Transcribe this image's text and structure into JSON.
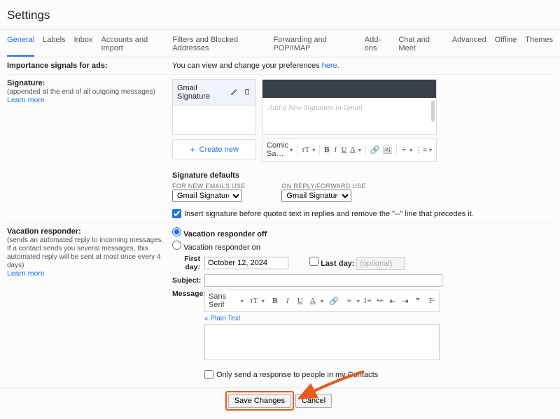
{
  "page_title": "Settings",
  "tabs": [
    "General",
    "Labels",
    "Inbox",
    "Accounts and Import",
    "Filters and Blocked Addresses",
    "Forwarding and POP/IMAP",
    "Add-ons",
    "Chat and Meet",
    "Advanced",
    "Offline",
    "Themes"
  ],
  "active_tab": "General",
  "ads": {
    "label": "Importance signals for ads:",
    "text_prefix": "You can view and change your preferences ",
    "link": "here"
  },
  "signature": {
    "label": "Signature:",
    "sub": "(appended at the end of all outgoing messages)",
    "learn": "Learn more",
    "list_item": "Gmail Signature",
    "preview_text": "Add a New Signature in Gmail",
    "font_name": "Comic Sa…",
    "create_new": "Create new",
    "defaults_heading": "Signature defaults",
    "new_emails_label": "FOR NEW EMAILS USE",
    "reply_label": "ON REPLY/FORWARD USE",
    "select_value": "Gmail Signature",
    "insert_checkbox": "Insert signature before quoted text in replies and remove the \"--\" line that precedes it."
  },
  "vacation": {
    "label": "Vacation responder:",
    "sub": "(sends an automated reply to incoming messages. If a contact sends you several messages, this automated reply will be sent at most once every 4 days)",
    "learn": "Learn more",
    "off": "Vacation responder off",
    "on": "Vacation responder on",
    "first_day_label": "First day:",
    "first_day_value": "October 12, 2024",
    "last_day_label": "Last day:",
    "last_day_placeholder": "(optional)",
    "subject_label": "Subject:",
    "message_label": "Message:",
    "font_name": "Sans Serif",
    "plain_text": "« Plain Text",
    "contacts_only": "Only send a response to people in my Contacts"
  },
  "footer": {
    "save": "Save Changes",
    "cancel": "Cancel"
  }
}
